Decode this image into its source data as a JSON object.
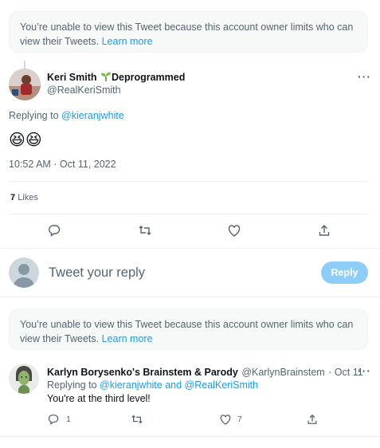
{
  "notice_top": {
    "text": "You’re unable to view this Tweet because this account owner limits who can view their Tweets.",
    "learn_more": "Learn more"
  },
  "tweet": {
    "author_name": "Keri Smith",
    "author_suffix": "Deprogrammed",
    "author_handle": "@RealKeriSmith",
    "replying_label": "Replying to",
    "replying_to": "@kieranjwhite",
    "emoji": "😆😆",
    "timestamp": "10:52 AM · Oct 11, 2022",
    "likes_count": "7",
    "likes_label": "Likes"
  },
  "composer": {
    "placeholder": "Tweet your reply",
    "reply_label": "Reply"
  },
  "notice_bottom": {
    "text": "You’re unable to view this Tweet because this account owner limits who can view their Tweets.",
    "learn_more": "Learn more"
  },
  "reply_tweet": {
    "author_name": "Karlyn Borysenko's Brainstem & Parody",
    "author_handle": "@KarlynBrainstem",
    "date": "· Oct 11",
    "replying_label": "Replying to",
    "replying_to": "@kieranjwhite and @RealKeriSmith",
    "text": "You're at the third level!",
    "reply_count": "1",
    "like_count": "7"
  },
  "colors": {
    "accent": "#1d9bf0",
    "reply_disabled": "#8ecdf7",
    "muted": "#536471"
  }
}
